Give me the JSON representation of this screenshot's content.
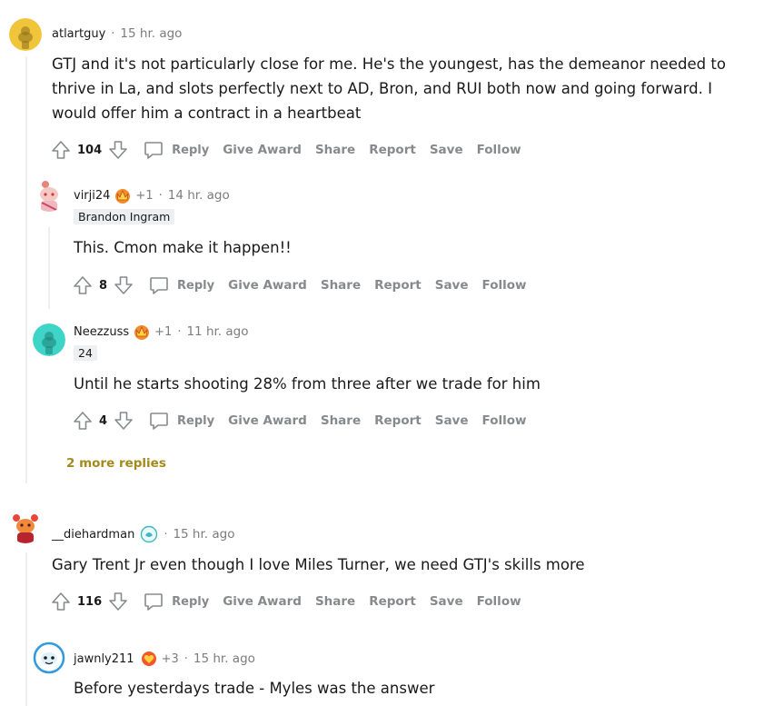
{
  "comments": [
    {
      "username": "atlartguy",
      "time": "15 hr. ago",
      "body": "GTJ and it's not particularly close for me. He's the youngest, has the demeanor needed to thrive in La, and slots perfectly next to AD, Bron, and RUI both now and going forward. I would offer him a contract in a heartbeat",
      "score": "104",
      "avatar_color": "#f0c53a"
    },
    {
      "username": "virji24",
      "karma": "+1",
      "time": "14 hr. ago",
      "flair": "Brandon Ingram",
      "body": "This. Cmon make it happen!!",
      "score": "8",
      "avatar_color": "#e85a7a"
    },
    {
      "username": "Neezzuss",
      "karma": "+1",
      "time": "11 hr. ago",
      "flair": "24",
      "body": "Until he starts shooting 28% from three after we trade for him",
      "score": "4",
      "avatar_color": "#3fd4c8"
    },
    {
      "username": "__diehardman",
      "time": "15 hr. ago",
      "body": "Gary Trent Jr even though I love Miles Turner, we need GTJ's skills more",
      "score": "116",
      "avatar_color": "#d9442b"
    },
    {
      "username": "jawnly211",
      "karma": "+3",
      "time": "15 hr. ago",
      "body": "Before yesterdays trade - Myles was the answer",
      "avatar_color": "#2f9ae0"
    }
  ],
  "actions": {
    "reply": "Reply",
    "give_award": "Give Award",
    "share": "Share",
    "report": "Report",
    "save": "Save",
    "follow": "Follow"
  },
  "more_replies": "2 more replies",
  "separator": "·",
  "colors": {
    "text": "#1a1a1b",
    "muted": "#878a8c",
    "more_replies": "#a48a1c",
    "thread_line": "#edeff1"
  }
}
